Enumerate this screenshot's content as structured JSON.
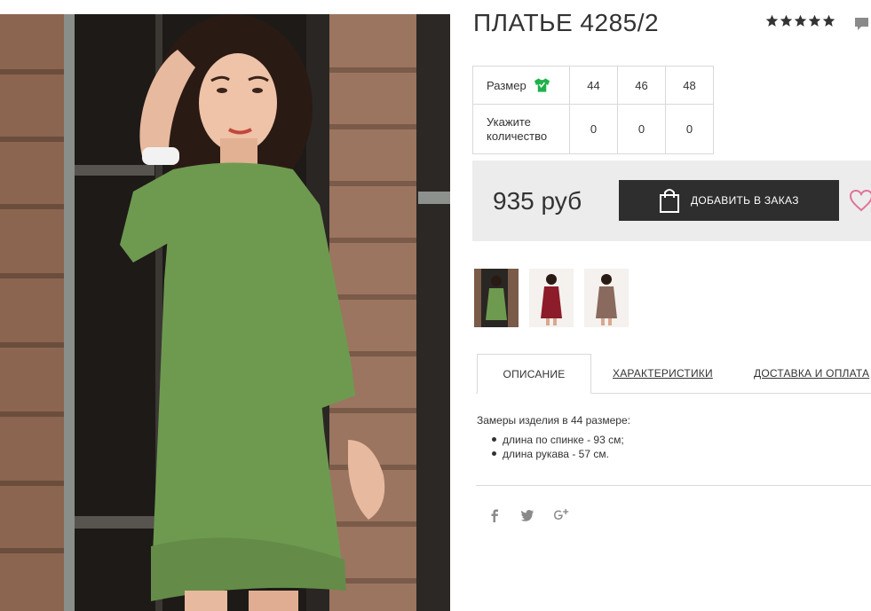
{
  "product": {
    "title": "ПЛАТЬЕ 4285/2",
    "rating_stars": 5
  },
  "sizes": {
    "size_label": "Размер",
    "qty_label": "Укажите количество",
    "items": [
      {
        "size": "44",
        "qty": "0"
      },
      {
        "size": "46",
        "qty": "0"
      },
      {
        "size": "48",
        "qty": "0"
      }
    ]
  },
  "purchase": {
    "price": "935 руб",
    "add_button_label": "ДОБАВИТЬ В ЗАКАЗ"
  },
  "colors": [
    "#6e9a50",
    "#8c1c2a",
    "#8a6a5e"
  ],
  "tabs": [
    {
      "label": "ОПИСАНИЕ",
      "active": true
    },
    {
      "label": "ХАРАКТЕРИСТИКИ",
      "active": false
    },
    {
      "label": "ДОСТАВКА И ОПЛАТА",
      "active": false
    }
  ],
  "description": {
    "intro": "Замеры изделия в 44 размере:",
    "items": [
      "длина по спинке - 93 см;",
      "длина рукава - 57 см."
    ]
  },
  "social": [
    "facebook-icon",
    "twitter-icon",
    "google-plus-icon"
  ],
  "theme": {
    "accent_green": "#1fb24a",
    "heart_pink": "#e0739a",
    "button_dark": "#2e2e2e"
  }
}
